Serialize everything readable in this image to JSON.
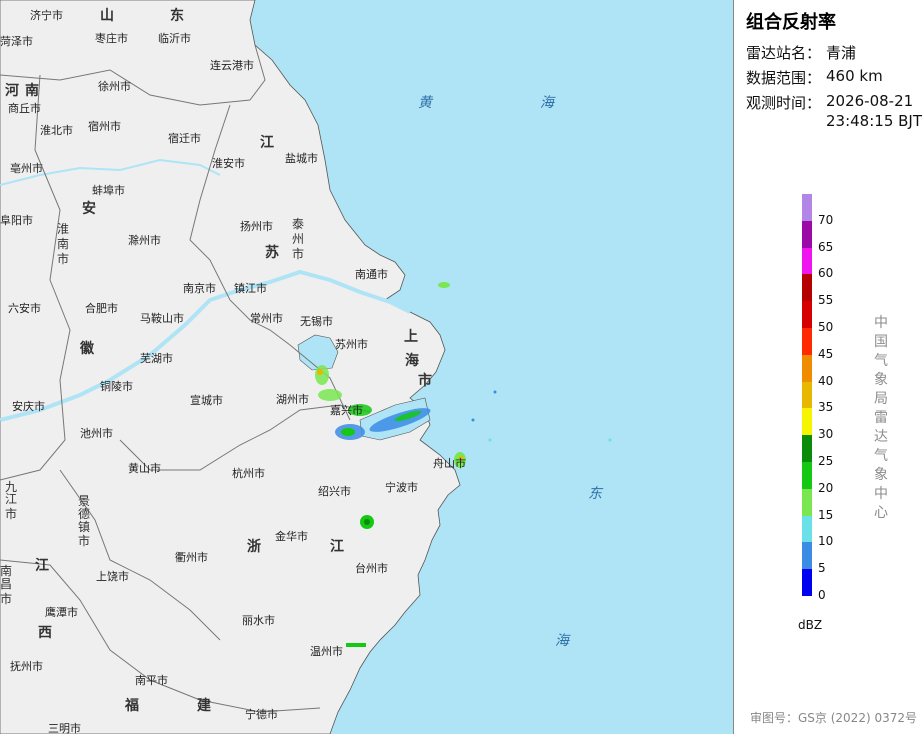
{
  "panel": {
    "title": "组合反射率",
    "station_label": "雷达站名：",
    "station_value": "青浦",
    "range_label": "数据范围：",
    "range_value": "460 km",
    "time_label": "观测时间：",
    "time_date": "2026-08-21",
    "time_clock": "23:48:15 BJT",
    "unit": "dBZ",
    "vertical_text": "中国气象局雷达气象中心",
    "review_no": "审图号：GS京 (2022) 0372号"
  },
  "legend": [
    {
      "value": "70",
      "color": "#b286e6"
    },
    {
      "value": "65",
      "color": "#9b0aa6"
    },
    {
      "value": "60",
      "color": "#f014f0"
    },
    {
      "value": "55",
      "color": "#b40000"
    },
    {
      "value": "50",
      "color": "#d60000"
    },
    {
      "value": "45",
      "color": "#ff2a00"
    },
    {
      "value": "40",
      "color": "#f08c00"
    },
    {
      "value": "35",
      "color": "#e8b800"
    },
    {
      "value": "30",
      "color": "#f5f500"
    },
    {
      "value": "25",
      "color": "#0a8c0a"
    },
    {
      "value": "20",
      "color": "#14c814"
    },
    {
      "value": "15",
      "color": "#7ae650"
    },
    {
      "value": "10",
      "color": "#6ae0e8"
    },
    {
      "value": "5",
      "color": "#3c8ce6"
    },
    {
      "value": "0",
      "color": "#0000f0"
    }
  ],
  "map": {
    "colors": {
      "land": "#efefef",
      "sea": "#aee4f5",
      "border": "#777777"
    },
    "seas": [
      "黄",
      "海",
      "东",
      "海"
    ],
    "provinces": [
      "山",
      "东",
      "河",
      "南",
      "江",
      "苏",
      "安",
      "徽",
      "上",
      "海",
      "市",
      "浙",
      "江",
      "江",
      "西",
      "福",
      "建",
      "九",
      "江",
      "市",
      "景",
      "德",
      "镇",
      "市",
      "泰",
      "州",
      "市",
      "淮",
      "南",
      "市",
      "南",
      "昌",
      "市"
    ],
    "cities": [
      "济宁市",
      "枣庄市",
      "临沂市",
      "菏泽市",
      "连云港市",
      "徐州市",
      "商丘市",
      "淮北市",
      "宿州市",
      "宿迁市",
      "盐城市",
      "亳州市",
      "蚌埠市",
      "淮安市",
      "阜阳市",
      "滁州市",
      "扬州市",
      "南通市",
      "六安市",
      "合肥市",
      "南京市",
      "镇江市",
      "马鞍山市",
      "常州市",
      "无锡市",
      "芜湖市",
      "苏州市",
      "铜陵市",
      "湖州市",
      "嘉兴市",
      "安庆市",
      "宣城市",
      "池州市",
      "舟山市",
      "黄山市",
      "杭州市",
      "绍兴市",
      "宁波市",
      "金华市",
      "衢州市",
      "上饶市",
      "台州市",
      "鹰潭市",
      "丽水市",
      "温州市",
      "抚州市",
      "南平市",
      "宁德市",
      "三明市"
    ]
  }
}
